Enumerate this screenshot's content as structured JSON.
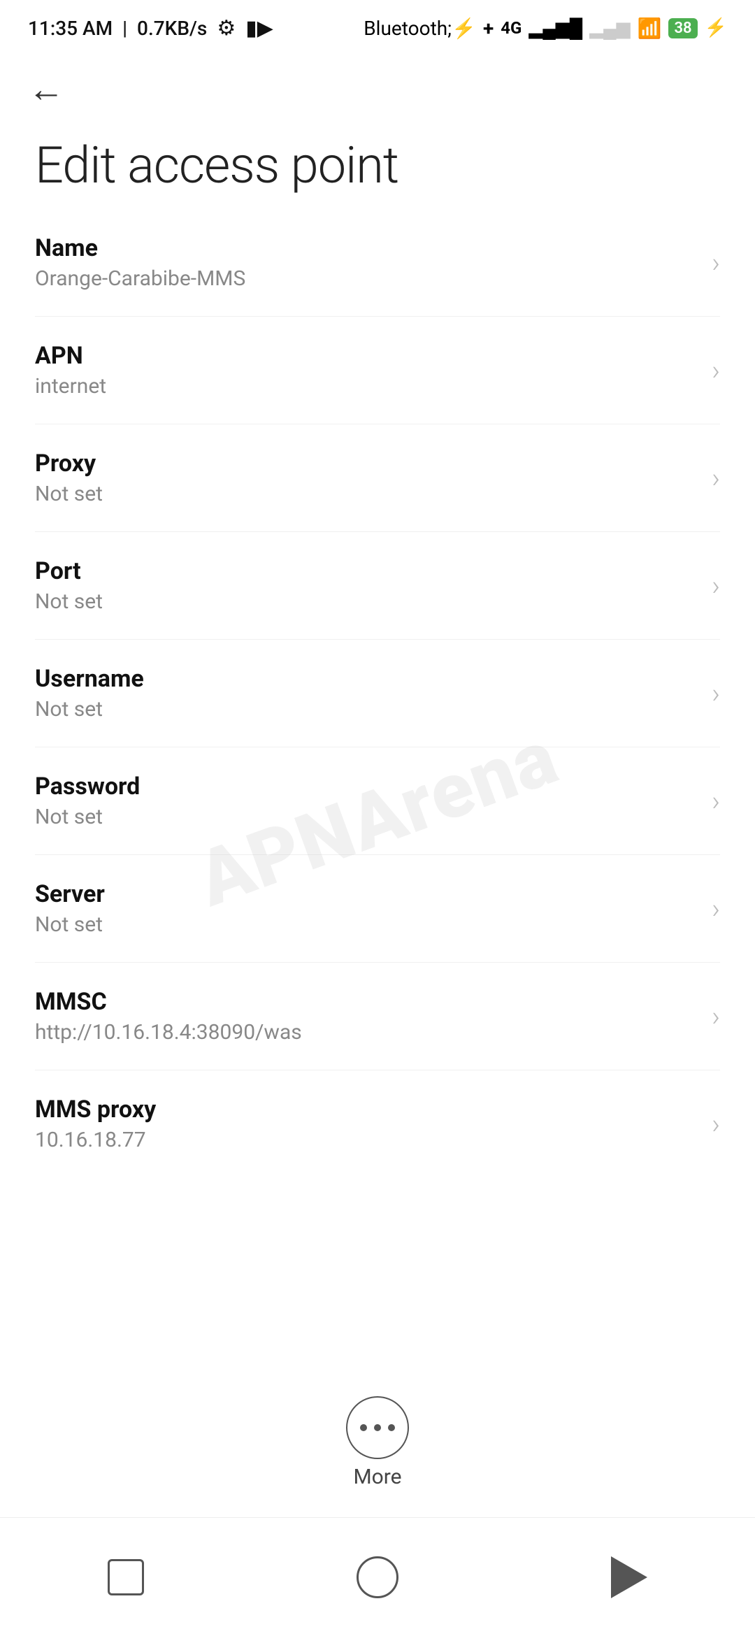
{
  "statusBar": {
    "time": "11:35 AM",
    "speed": "0.7KB/s"
  },
  "page": {
    "title": "Edit access point",
    "backLabel": "←"
  },
  "settings": [
    {
      "label": "Name",
      "value": "Orange-Carabibe-MMS"
    },
    {
      "label": "APN",
      "value": "internet"
    },
    {
      "label": "Proxy",
      "value": "Not set"
    },
    {
      "label": "Port",
      "value": "Not set"
    },
    {
      "label": "Username",
      "value": "Not set"
    },
    {
      "label": "Password",
      "value": "Not set"
    },
    {
      "label": "Server",
      "value": "Not set"
    },
    {
      "label": "MMSC",
      "value": "http://10.16.18.4:38090/was"
    },
    {
      "label": "MMS proxy",
      "value": "10.16.18.77"
    }
  ],
  "more": {
    "label": "More"
  },
  "watermark": "APNArena"
}
